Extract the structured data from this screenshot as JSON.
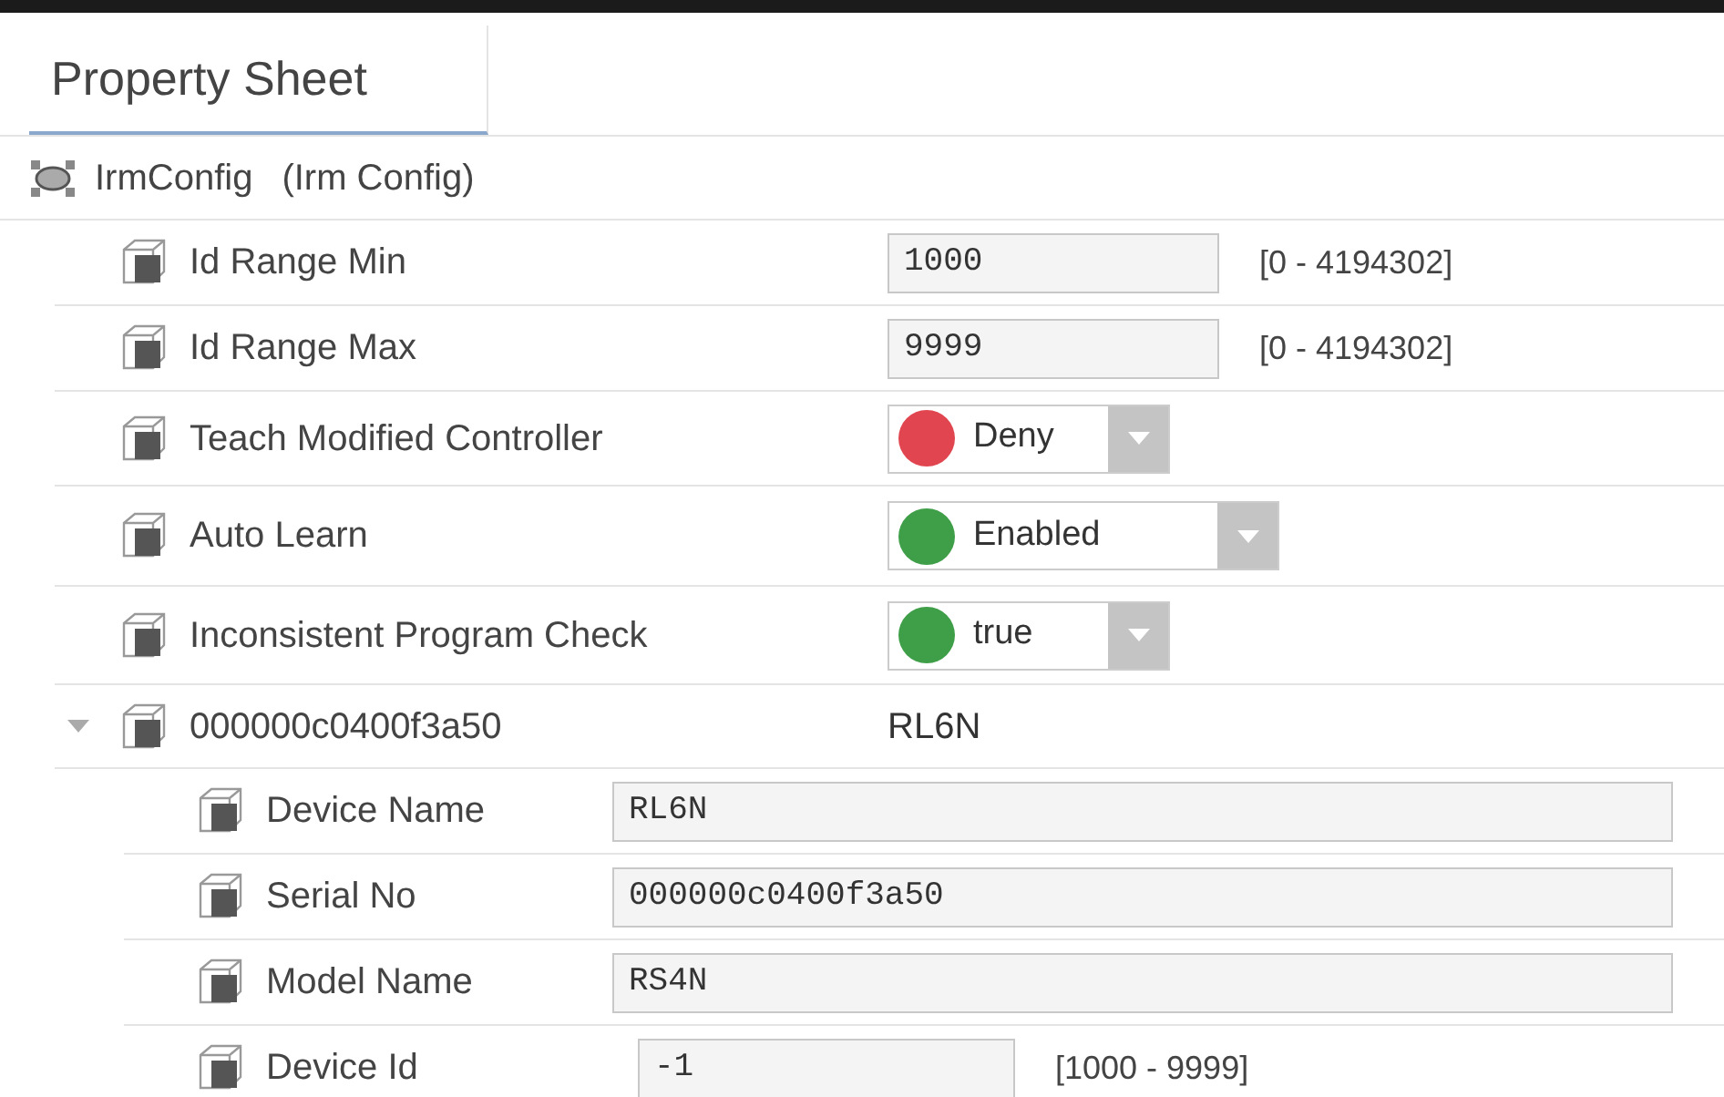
{
  "tab": {
    "label": "Property Sheet",
    "selected": true
  },
  "root": {
    "name": "IrmConfig",
    "type": "(Irm Config)"
  },
  "properties": [
    {
      "kind": "number",
      "label": "Id Range Min",
      "value": "1000",
      "range": "[0 - 4194302]"
    },
    {
      "kind": "number",
      "label": "Id Range Max",
      "value": "9999",
      "range": "[0 - 4194302]"
    },
    {
      "kind": "enum",
      "label": "Teach Modified Controller",
      "value": "Deny",
      "color": "#e04550"
    },
    {
      "kind": "enum",
      "label": "Auto Learn",
      "value": "Enabled",
      "color": "#3f9e48"
    },
    {
      "kind": "enum",
      "label": "Inconsistent Program Check",
      "value": "true",
      "color": "#3f9e48"
    }
  ],
  "device": {
    "name": "000000c0400f3a50",
    "summary": "RL6N",
    "expanded": true,
    "children": [
      {
        "kind": "text",
        "label": "Device Name",
        "value": "RL6N"
      },
      {
        "kind": "text",
        "label": "Serial No",
        "value": "000000c0400f3a50"
      },
      {
        "kind": "text",
        "label": "Model Name",
        "value": "RS4N"
      },
      {
        "kind": "number",
        "label": "Device Id",
        "value": "-1",
        "range": "[1000 - 9999]"
      }
    ]
  }
}
